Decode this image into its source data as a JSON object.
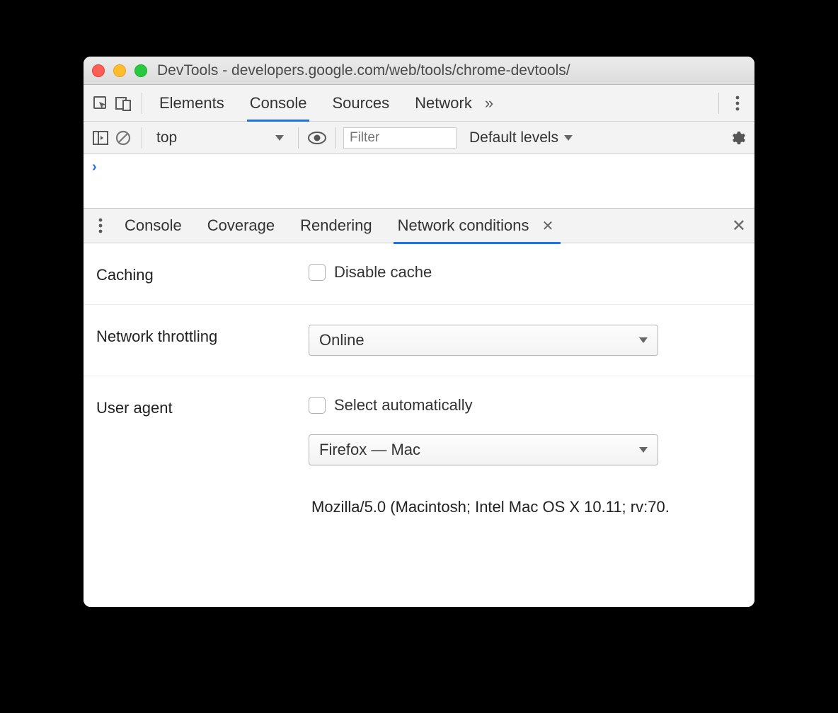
{
  "window": {
    "title": "DevTools - developers.google.com/web/tools/chrome-devtools/"
  },
  "tabs": {
    "items": [
      "Elements",
      "Console",
      "Sources",
      "Network"
    ],
    "active": "Console",
    "overflow": "»"
  },
  "console_toolbar": {
    "context": "top",
    "filter_placeholder": "Filter",
    "levels_label": "Default levels"
  },
  "drawer": {
    "tabs": [
      "Console",
      "Coverage",
      "Rendering",
      "Network conditions"
    ],
    "active": "Network conditions"
  },
  "network_conditions": {
    "caching": {
      "label": "Caching",
      "checkbox_label": "Disable cache"
    },
    "throttling": {
      "label": "Network throttling",
      "value": "Online"
    },
    "user_agent": {
      "label": "User agent",
      "auto_label": "Select automatically",
      "value": "Firefox — Mac",
      "ua_string": "Mozilla/5.0 (Macintosh; Intel Mac OS X 10.11; rv:70."
    }
  }
}
